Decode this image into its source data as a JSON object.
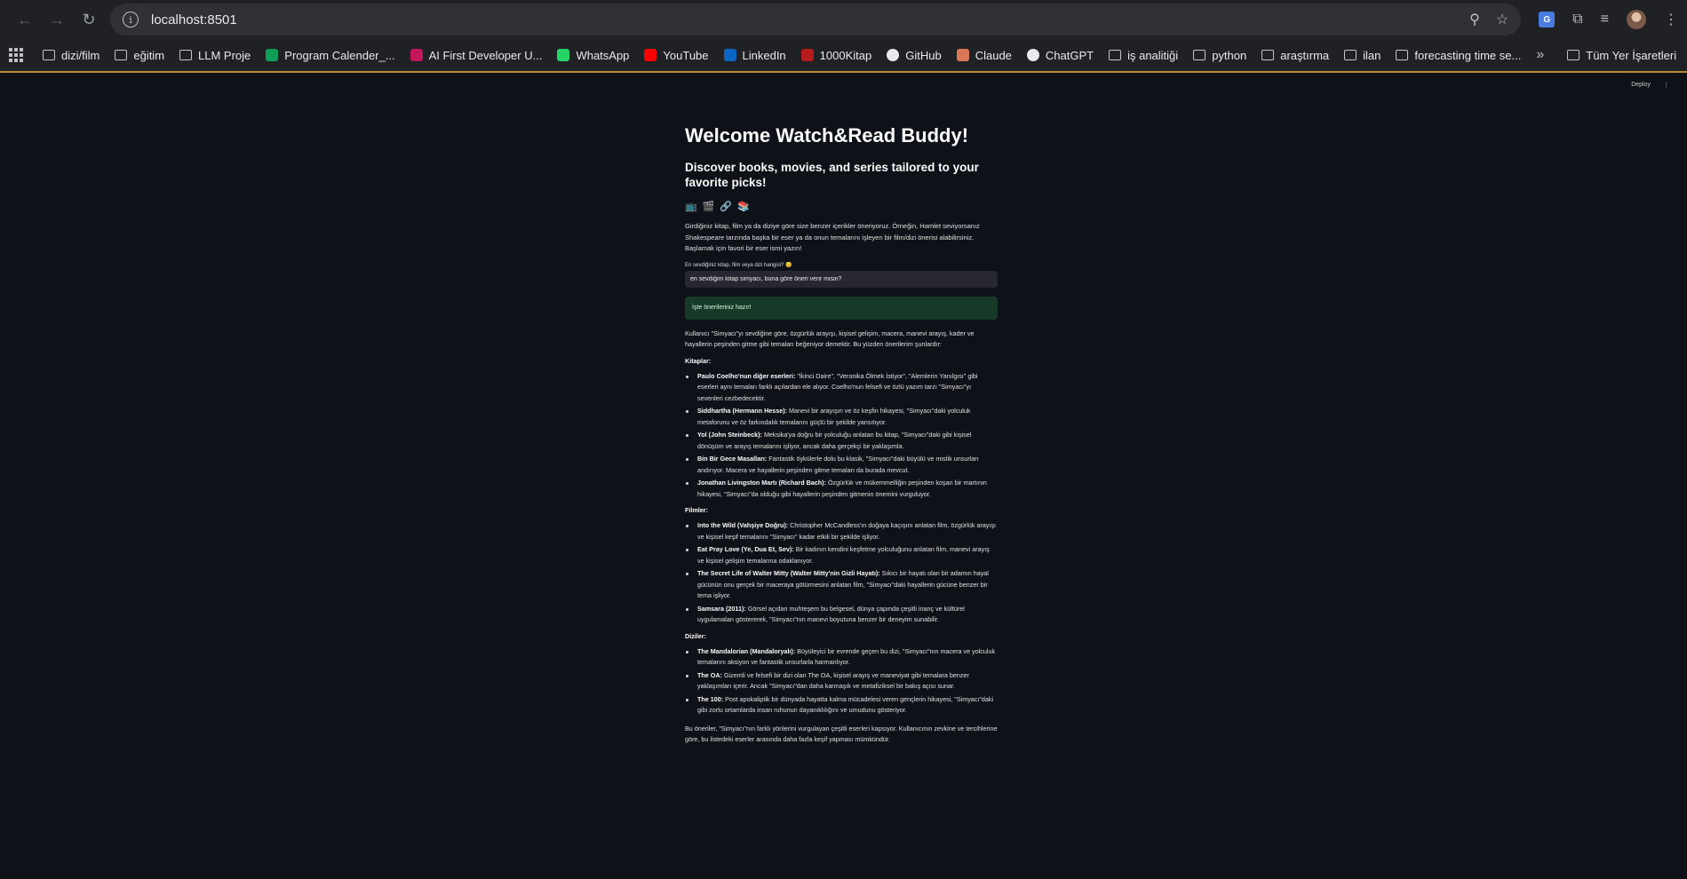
{
  "browser": {
    "url": "localhost:8501",
    "bookmarks": [
      {
        "label": "dizi/film",
        "icon": "folder-icon"
      },
      {
        "label": "eğitim",
        "icon": "folder-icon"
      },
      {
        "label": "LLM Proje",
        "icon": "folder-icon"
      },
      {
        "label": "Program Calender_...",
        "icon": "sheets-icon"
      },
      {
        "label": "AI First Developer U...",
        "icon": "person-icon"
      },
      {
        "label": "WhatsApp",
        "icon": "whatsapp-icon"
      },
      {
        "label": "YouTube",
        "icon": "youtube-icon"
      },
      {
        "label": "LinkedIn",
        "icon": "linkedin-icon"
      },
      {
        "label": "1000Kitap",
        "icon": "1000kitap-icon"
      },
      {
        "label": "GitHub",
        "icon": "github-icon"
      },
      {
        "label": "Claude",
        "icon": "claude-icon"
      },
      {
        "label": "ChatGPT",
        "icon": "chatgpt-icon"
      },
      {
        "label": "iş analitiği",
        "icon": "folder-icon"
      },
      {
        "label": "python",
        "icon": "folder-icon"
      },
      {
        "label": "araştırma",
        "icon": "folder-icon"
      },
      {
        "label": "ilan",
        "icon": "folder-icon"
      },
      {
        "label": "forecasting time se...",
        "icon": "folder-icon"
      }
    ],
    "all_bookmarks": "Tüm Yer İşaretleri",
    "overflow": "»"
  },
  "app": {
    "deploy": "Deploy",
    "menu": "⋮",
    "title": "Welcome Watch&Read Buddy!",
    "subtitle": "Discover books, movies, and series tailored to your favorite picks!",
    "emojis": [
      "📺",
      "🎬",
      "🔗",
      "📚"
    ],
    "intro": "Girdiğiniz kitap, film ya da diziye göre size benzer içerikler öneriyoruz. Örneğin, Hamlet seviyorsanız Shakespeare tarzında başka bir eser ya da onun temalarını işleyen bir film/dizi önerisi alabilirsiniz. Başlamak için favori bir eser ismi yazın!",
    "input_label": "En sevdiğiniz kitap, film veya dizi hangisi? 😊",
    "input_value": "en sevdiğim kitap simyacı, buna göre öneri verir misin?",
    "success": "İşte önerileriniz hazır!",
    "lead": "Kullanıcı \"Simyacı\"yı sevdiğine göre, özgürlük arayışı, kişisel gelişim, macera, manevi arayış, kader ve hayallerin peşinden gitme gibi temaları beğeniyor demektir. Bu yüzden önerilerim şunlardır:",
    "sections": [
      {
        "heading": "Kitaplar:",
        "items": [
          {
            "title": "Paulo Coelho'nun diğer eserleri:",
            "text": " \"İkinci Daire\", \"Veronika Ölmek İstiyor\", \"Alemlerin Yanılgısı\" gibi eserleri aynı temaları farklı açılardan ele alıyor. Coelho'nun felsefi ve özlü yazım tarzı \"Simyacı\"yı sevenleri cezbedecektir."
          },
          {
            "title": "Siddhartha (Hermann Hesse):",
            "text": " Manevi bir arayışın ve öz keşfin hikayesi, \"Simyacı\"daki yolculuk metaforunu ve öz farkındalık temalarını güçlü bir şekilde yansıtıyor."
          },
          {
            "title": "Yol (John Steinbeck):",
            "text": " Meksika'ya doğru bir yolculuğu anlatan bu kitap, \"Simyacı\"daki gibi kişisel dönüşüm ve arayış temalarını işliyor, ancak daha gerçekçi bir yaklaşımla."
          },
          {
            "title": "Bin Bir Gece Masalları:",
            "text": " Fantastik öykülerle dolu bu klasik, \"Simyacı\"daki büyülü ve mistik unsurları andırıyor. Macera ve hayallerin peşinden gitme temaları da burada mevcut."
          },
          {
            "title": "Jonathan Livingston Martı (Richard Bach):",
            "text": " Özgürlük ve mükemmelliğin peşinden koşan bir martının hikayesi, \"Simyacı\"da olduğu gibi hayallerin peşinden gitmenin önemini vurguluyor."
          }
        ]
      },
      {
        "heading": "Filmler:",
        "items": [
          {
            "title": "Into the Wild (Vahşiye Doğru):",
            "text": " Christopher McCandless'ın doğaya kaçışını anlatan film, özgürlük arayışı ve kişisel keşif temalarını \"Simyacı\" kadar etkili bir şekilde işliyor."
          },
          {
            "title": "Eat Pray Love (Ye, Dua Et, Sev):",
            "text": " Bir kadının kendini keşfetme yolculuğunu anlatan film, manevi arayış ve kişisel gelişim temalarına odaklanıyor."
          },
          {
            "title": "The Secret Life of Walter Mitty (Walter Mitty'nin Gizli Hayatı):",
            "text": " Sıkıcı bir hayatı olan bir adamın hayal gücünün onu gerçek bir maceraya götürmesini anlatan film, \"Simyacı\"daki hayallerin gücüne benzer bir tema işliyor."
          },
          {
            "title": "Samsara (2011):",
            "text": " Görsel açıdan muhteşem bu belgesel, dünya çapında çeşitli inanç ve kültürel uygulamaları göstererek, \"Simyacı\"nın manevi boyutuna benzer bir deneyim sunabilir."
          }
        ]
      },
      {
        "heading": "Diziler:",
        "items": [
          {
            "title": "The Mandalorian (Mandaloryalı):",
            "text": " Büyüleyici bir evrende geçen bu dizi, \"Simyacı\"nın macera ve yolculuk temalarını aksiyon ve fantastik unsurlarla harmanlıyor."
          },
          {
            "title": "The OA:",
            "text": " Gizemli ve felsefi bir dizi olan The OA, kişisel arayış ve maneviyat gibi temalara benzer yaklaşımları içerir. Ancak \"Simyacı\"dan daha karmaşık ve metafiziksel bir bakış açısı sunar."
          },
          {
            "title": "The 100:",
            "text": " Post apokaliptik bir dünyada hayatta kalma mücadelesi veren gençlerin hikayesi, \"Simyacı\"daki gibi zorlu ortamlarda insan ruhunun dayanıklılığını ve umudunu gösteriyor."
          }
        ]
      }
    ],
    "closing": "Bu öneriler, \"Simyacı\"nın farklı yönlerini vurgulayan çeşitli eserleri kapsıyor. Kullanıcının zevkine ve tercihlerine göre, bu listedeki eserler arasında daha fazla keşif yapması mümkündür."
  }
}
